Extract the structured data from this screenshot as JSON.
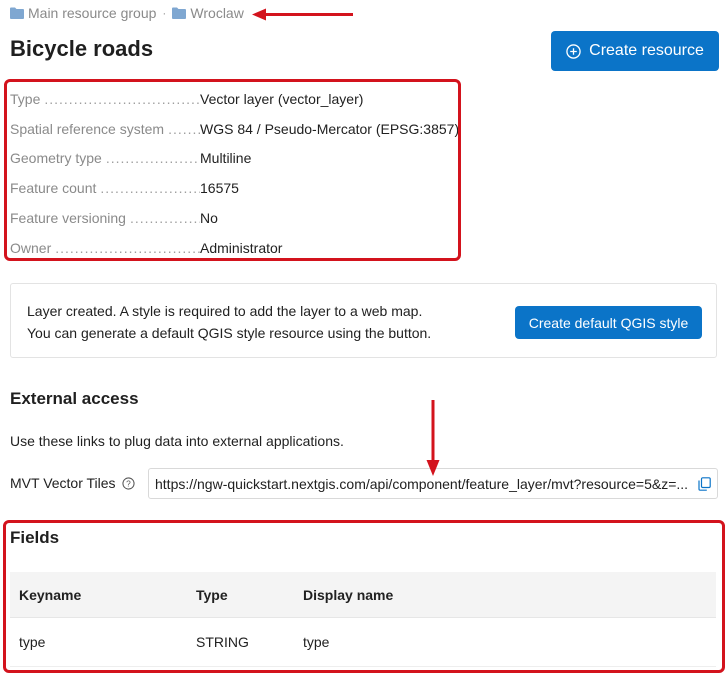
{
  "breadcrumbs": [
    {
      "label": "Main resource group"
    },
    {
      "label": "Wroclaw"
    }
  ],
  "breadcrumb_separator": "·",
  "title": "Bicycle roads",
  "create_button": {
    "label": "Create resource",
    "icon": "plus-circle-icon"
  },
  "properties": [
    {
      "key": "Type",
      "value": "Vector layer (vector_layer)"
    },
    {
      "key": "Spatial reference system",
      "value": "WGS 84 / Pseudo-Mercator (EPSG:3857)"
    },
    {
      "key": "Geometry type",
      "value": "Multiline"
    },
    {
      "key": "Feature count",
      "value": "16575"
    },
    {
      "key": "Feature versioning",
      "value": "No"
    },
    {
      "key": "Owner",
      "value": "Administrator"
    }
  ],
  "notice": {
    "line1": "Layer created. A style is required to add the layer to a web map.",
    "line2": "You can generate a default QGIS style resource using the button.",
    "button": "Create default QGIS style"
  },
  "external_access": {
    "title": "External access",
    "description": "Use these links to plug data into external applications.",
    "mvt_label": "MVT Vector Tiles",
    "mvt_url": "https://ngw-quickstart.nextgis.com/api/component/feature_layer/mvt?resource=5&z=..."
  },
  "fields": {
    "title": "Fields",
    "columns": [
      "Keyname",
      "Type",
      "Display name"
    ],
    "rows": [
      [
        "type",
        "STRING",
        "type"
      ]
    ]
  },
  "colors": {
    "accent": "#0b74c8",
    "annotation": "#d3131d"
  }
}
